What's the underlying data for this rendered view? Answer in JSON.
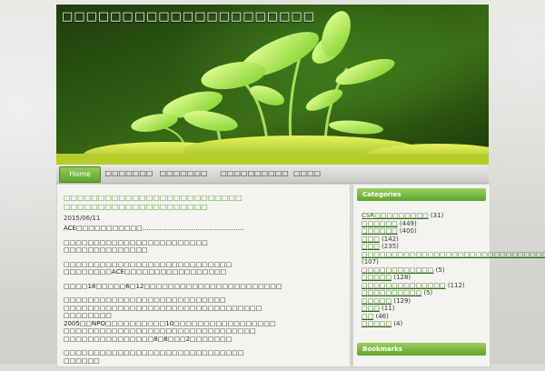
{
  "site": {
    "title": "□□□□□□□□□□□□□□□□□□□□□"
  },
  "nav": {
    "items": [
      {
        "label": "Home",
        "active": true
      },
      {
        "label": "□□□□□□□"
      },
      {
        "label": "□□□□□□□"
      },
      {
        "label": "□□□□□□□□□□"
      },
      {
        "label": "□□□□"
      }
    ]
  },
  "post": {
    "title": "□□□□□□□□□□□□□□□□□□□□□□□□□□ □□□□□□□□□□□□□□□□□□□□□",
    "date": "2015/06/11",
    "paragraphs": [
      "ACE□□□□□□□□□□□…………………………………………",
      "□□□□□□□□□□□□□□□□□□□□□□□□\n□□□□□□□□□□□□□□",
      "□□□□□□□□□□□□□□□□□□□□□□□□□□□□\n□□□□□□□□ACE□□□□□□□□□□□□□□□□□",
      "□□□□18□□□□□6□12□□□□□□□□□□□□□□□□□□□□□□□",
      "□□□□□□□□□□□□□□□□□□□□□□□□□□□\n□□□□□□□□□□□□□□□□□□□□□□□□□□□□□□□□□\n□□□□□□□□\n2005□□NPO□□□□□□□□□□10□□□□□□□□□□□□□□□□□\n□□□□□□□□□□□□□□□□□□□□□□□□□□□□□□□□\n□□□□□□□□□□□□□□□8□8□□□2□□□□□□□",
      "□□□□□□□□□□□□□□□□□□□□□□□□□□□□□□\n□□□□□□"
    ]
  },
  "sidebar": {
    "categories_title": "Categories",
    "categories": [
      {
        "name": "CSR□□□□□□□□□",
        "count": "(31)"
      },
      {
        "name": "□□□□□□",
        "count": "(449)"
      },
      {
        "name": "□□□□□□",
        "count": "(400)"
      },
      {
        "name": "□□□",
        "count": "(142)"
      },
      {
        "name": "□□□",
        "count": "(235)"
      },
      {
        "name": "□□□□□□□□□□□□□□□□□□□□□□□□□□□□□□□",
        "count": "(107)"
      },
      {
        "name": "□□□□□□□□□□□□",
        "count": "(5)"
      },
      {
        "name": "□□□□□",
        "count": "(128)"
      },
      {
        "name": "□□□□□□□□□□□□□□",
        "count": "(112)"
      },
      {
        "name": "□□□□□□□□□□",
        "count": "(5)"
      },
      {
        "name": "□□□□□",
        "count": "(129)"
      },
      {
        "name": "□□□",
        "count": "(11)"
      },
      {
        "name": "□□",
        "count": "(46)"
      },
      {
        "name": "□□□□□",
        "count": "(4)"
      }
    ],
    "bookmarks_title": "Bookmarks"
  }
}
